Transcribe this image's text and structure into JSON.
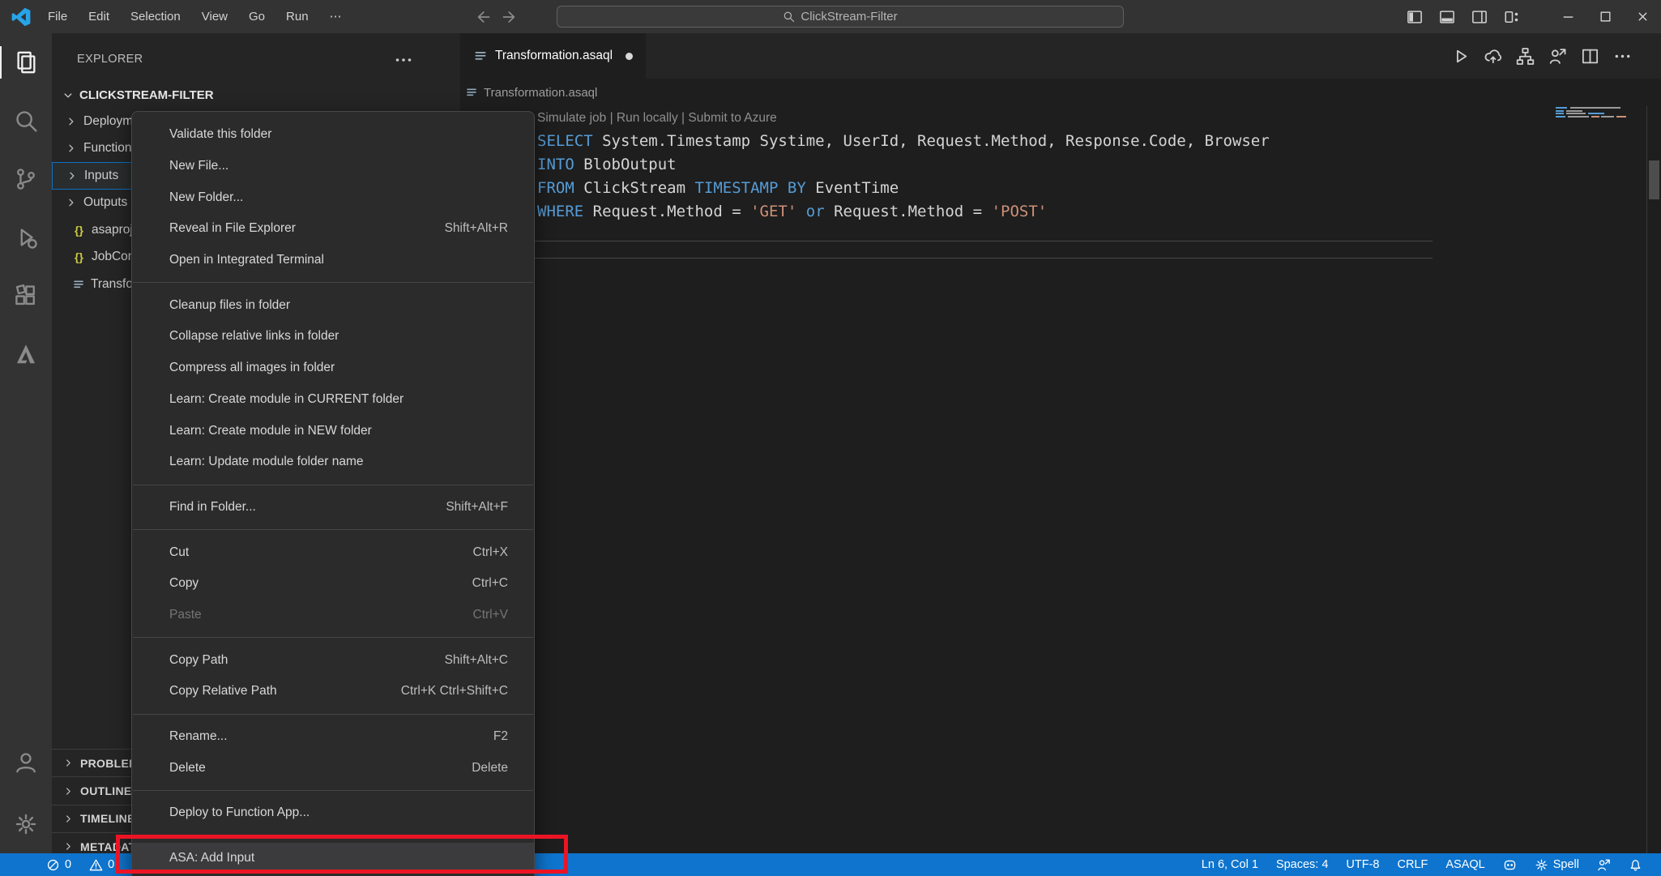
{
  "titlebar": {
    "menus": [
      "File",
      "Edit",
      "Selection",
      "View",
      "Go",
      "Run",
      "⋯"
    ],
    "command_center": "ClickStream-Filter",
    "window_controls": [
      "toggle-sidebar",
      "toggle-panel",
      "toggle-secondary-sidebar",
      "customize-layout",
      "minimize",
      "maximize",
      "close"
    ]
  },
  "activity_bar": {
    "top": [
      {
        "icon": "files",
        "name": "explorer",
        "active": true
      },
      {
        "icon": "search",
        "name": "search",
        "active": false
      },
      {
        "icon": "scm",
        "name": "source-control",
        "active": false
      },
      {
        "icon": "debug",
        "name": "run-and-debug",
        "active": false
      },
      {
        "icon": "extensions",
        "name": "extensions",
        "active": false
      },
      {
        "icon": "azure",
        "name": "azure",
        "active": false
      }
    ],
    "bottom": [
      {
        "icon": "account",
        "name": "account",
        "active": false
      },
      {
        "icon": "gear",
        "name": "settings",
        "active": false
      }
    ]
  },
  "sidebar": {
    "header": "EXPLORER",
    "root": "CLICKSTREAM-FILTER",
    "tree": [
      {
        "label": "Deployment",
        "type": "folder",
        "selected": false
      },
      {
        "label": "Functions",
        "type": "folder",
        "selected": false
      },
      {
        "label": "Inputs",
        "type": "folder",
        "selected": true
      },
      {
        "label": "Outputs",
        "type": "folder",
        "selected": false
      },
      {
        "label": "asaproj.json",
        "type": "json",
        "selected": false
      },
      {
        "label": "JobConfig.json",
        "type": "json",
        "selected": false
      },
      {
        "label": "Transformation.asaql",
        "type": "asaql",
        "selected": false
      }
    ],
    "sections": [
      "PROBLEMS",
      "OUTLINE",
      "TIMELINE",
      "METADATA"
    ]
  },
  "context_menu": {
    "groups": [
      [
        {
          "label": "Validate this folder"
        },
        {
          "label": "New File..."
        },
        {
          "label": "New Folder..."
        },
        {
          "label": "Reveal in File Explorer",
          "shortcut": "Shift+Alt+R"
        },
        {
          "label": "Open in Integrated Terminal"
        }
      ],
      [
        {
          "label": "Cleanup files in folder"
        },
        {
          "label": "Collapse relative links in folder"
        },
        {
          "label": "Compress all images in folder"
        },
        {
          "label": "Learn: Create module in CURRENT folder"
        },
        {
          "label": "Learn: Create module in NEW folder"
        },
        {
          "label": "Learn: Update module folder name"
        }
      ],
      [
        {
          "label": "Find in Folder...",
          "shortcut": "Shift+Alt+F"
        }
      ],
      [
        {
          "label": "Cut",
          "shortcut": "Ctrl+X"
        },
        {
          "label": "Copy",
          "shortcut": "Ctrl+C"
        },
        {
          "label": "Paste",
          "shortcut": "Ctrl+V",
          "disabled": true
        }
      ],
      [
        {
          "label": "Copy Path",
          "shortcut": "Shift+Alt+C"
        },
        {
          "label": "Copy Relative Path",
          "shortcut": "Ctrl+K Ctrl+Shift+C"
        }
      ],
      [
        {
          "label": "Rename...",
          "shortcut": "F2"
        },
        {
          "label": "Delete",
          "shortcut": "Delete"
        }
      ],
      [
        {
          "label": "Deploy to Function App..."
        }
      ],
      [
        {
          "label": "ASA: Add Input",
          "highlighted": true
        }
      ]
    ]
  },
  "editor": {
    "tab": {
      "label": "Transformation.asaql",
      "modified": true
    },
    "breadcrumb": "Transformation.asaql",
    "actions": [
      "run",
      "cloud-up",
      "hierarchy",
      "person-share",
      "split",
      "ellipsis"
    ],
    "codelens": "Simulate job | Run locally | Submit to Azure",
    "code_lines": [
      [
        {
          "t": "SELECT",
          "c": "kw"
        },
        {
          "t": " System.Timestamp Systime, UserId, Request.Method, Response.Code, Browser",
          "c": "id"
        }
      ],
      [
        {
          "t": "INTO",
          "c": "kw"
        },
        {
          "t": " BlobOutput",
          "c": "id"
        }
      ],
      [
        {
          "t": "FROM",
          "c": "kw"
        },
        {
          "t": " ClickStream ",
          "c": "id"
        },
        {
          "t": "TIMESTAMP",
          "c": "kw"
        },
        {
          "t": " ",
          "c": "id"
        },
        {
          "t": "BY",
          "c": "kw"
        },
        {
          "t": " EventTime",
          "c": "id"
        }
      ],
      [
        {
          "t": "WHERE",
          "c": "kw"
        },
        {
          "t": " Request.Method = ",
          "c": "id"
        },
        {
          "t": "'GET'",
          "c": "str"
        },
        {
          "t": " ",
          "c": "id"
        },
        {
          "t": "or",
          "c": "kw"
        },
        {
          "t": " Request.Method = ",
          "c": "id"
        },
        {
          "t": "'POST'",
          "c": "str"
        }
      ]
    ]
  },
  "status_bar": {
    "left": [
      {
        "icon": "error",
        "text": "0"
      },
      {
        "icon": "warning",
        "text": "0"
      }
    ],
    "right": [
      {
        "text": "Ln 6, Col 1"
      },
      {
        "text": "Spaces: 4"
      },
      {
        "text": "UTF-8"
      },
      {
        "text": "CRLF"
      },
      {
        "text": "ASAQL"
      },
      {
        "icon": "mask",
        "text": ""
      },
      {
        "icon": "gear",
        "text": "Spell"
      },
      {
        "icon": "person-share",
        "text": ""
      },
      {
        "icon": "bell",
        "text": ""
      }
    ]
  },
  "colors": {
    "statusbar": "#0e74cd",
    "annotation_red": "#ec1424",
    "keyword": "#569cd6",
    "string": "#ce9178",
    "code_text": "#d4d4d4",
    "selection_outline": "#0e70c0"
  }
}
